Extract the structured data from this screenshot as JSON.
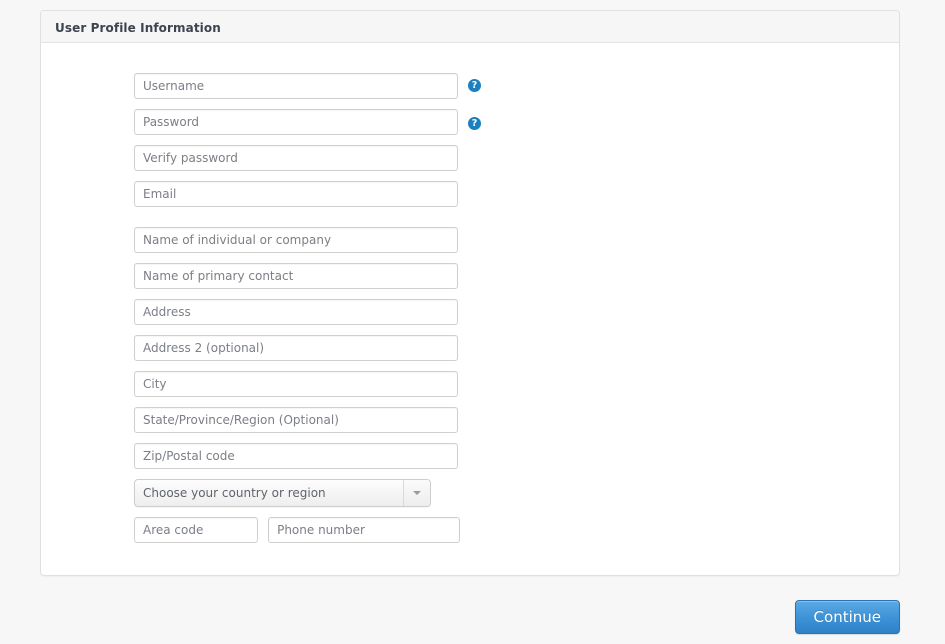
{
  "panel": {
    "title": "User Profile Information"
  },
  "form": {
    "account_fields": [
      {
        "name": "username",
        "placeholder": "Username",
        "help": true,
        "help_glyph": "?"
      },
      {
        "name": "password",
        "placeholder": "Password",
        "help": true,
        "help_glyph": "?"
      },
      {
        "name": "verify-password",
        "placeholder": "Verify password",
        "help": false
      },
      {
        "name": "email",
        "placeholder": "Email",
        "help": false
      }
    ],
    "profile_fields": [
      {
        "name": "company-name",
        "placeholder": "Name of individual or company"
      },
      {
        "name": "primary-contact",
        "placeholder": "Name of primary contact"
      },
      {
        "name": "address",
        "placeholder": "Address"
      },
      {
        "name": "address2",
        "placeholder": "Address 2 (optional)"
      },
      {
        "name": "city",
        "placeholder": "City"
      },
      {
        "name": "state",
        "placeholder": "State/Province/Region (Optional)"
      },
      {
        "name": "zip",
        "placeholder": "Zip/Postal code"
      }
    ],
    "country_select": {
      "selected": "Choose your country or region",
      "arrow_glyph": "▾"
    },
    "phone": {
      "area_code_placeholder": "Area code",
      "number_placeholder": "Phone number"
    }
  },
  "footer": {
    "continue_label": "Continue"
  },
  "colors": {
    "page_background": "#f7f7f7",
    "panel_background": "#ffffff",
    "panel_header_background": "#f6f6f6",
    "panel_border": "#e0e0e0",
    "title_text": "#3d4450",
    "placeholder_text": "#7b7f86",
    "input_border": "#cfcfcf",
    "help_icon_blue": "#1b7fc0",
    "primary_button_blue": "#3f93d8",
    "primary_button_border": "#2a72b0"
  }
}
